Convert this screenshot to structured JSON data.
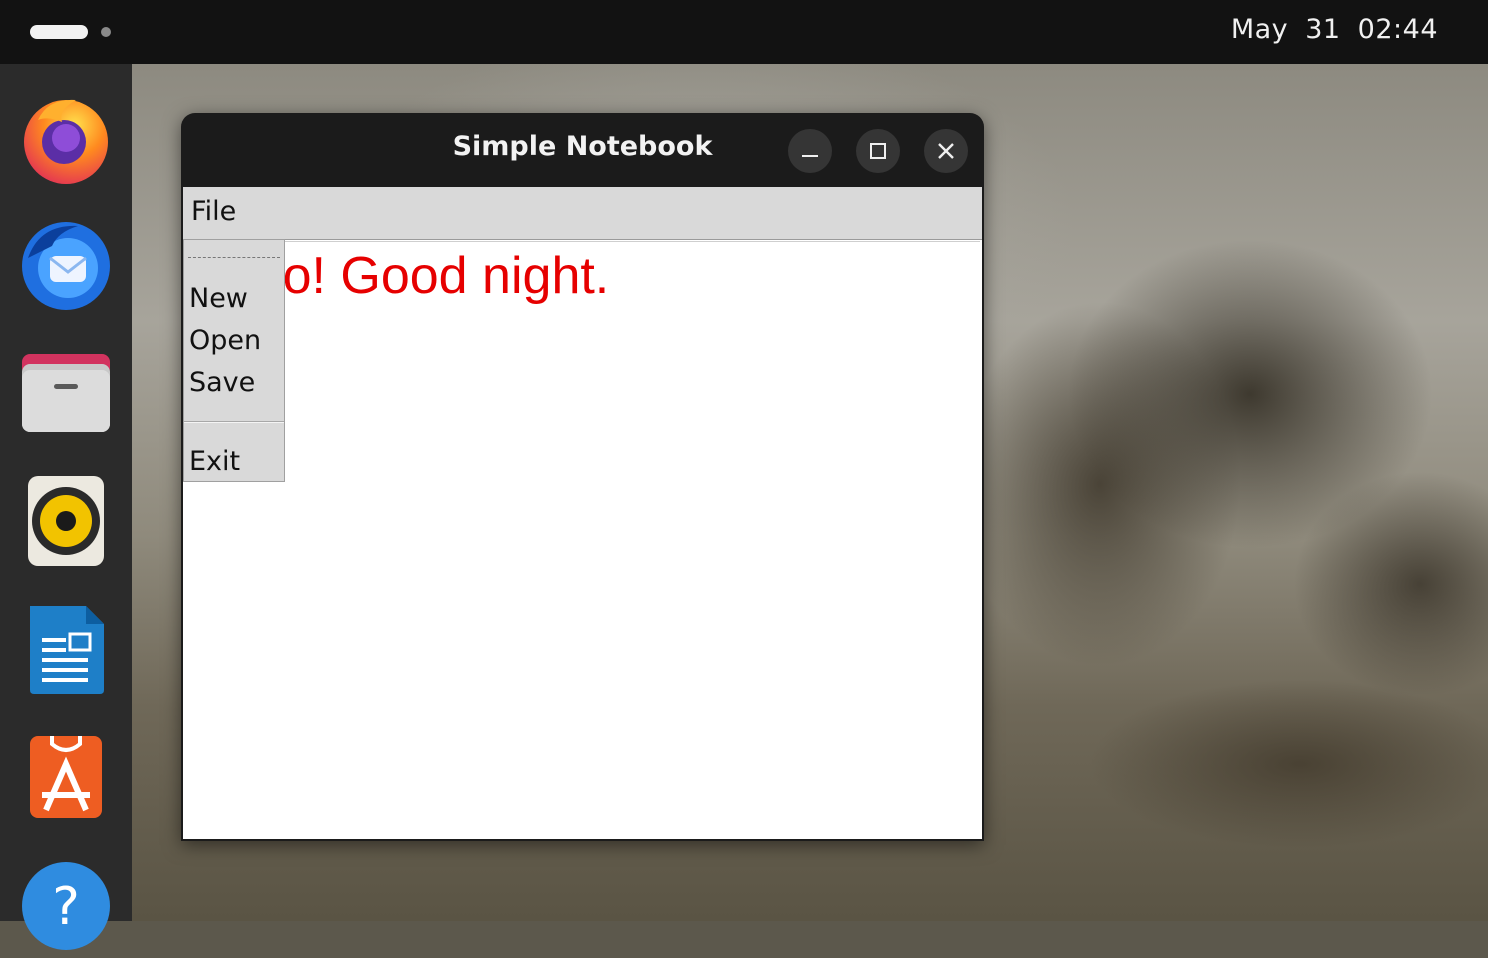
{
  "topbar": {
    "clock": "May 31  02:44"
  },
  "dock": {
    "items": [
      {
        "name": "firefox-icon"
      },
      {
        "name": "thunderbird-icon"
      },
      {
        "name": "files-icon"
      },
      {
        "name": "rhythmbox-icon"
      },
      {
        "name": "writer-icon"
      },
      {
        "name": "app-center-icon"
      },
      {
        "name": "help-icon"
      }
    ]
  },
  "window": {
    "title": "Simple Notebook",
    "menubar": {
      "file_label": "File"
    },
    "text_content": "Hello! Good night.",
    "dropdown": {
      "items": [
        "New",
        "Open",
        "Save",
        "Exit"
      ]
    }
  },
  "colors": {
    "text_color": "#e60000",
    "menu_bg": "#d9d9d9",
    "topbar_bg": "#121212",
    "dock_bg": "#2b2b2b"
  }
}
